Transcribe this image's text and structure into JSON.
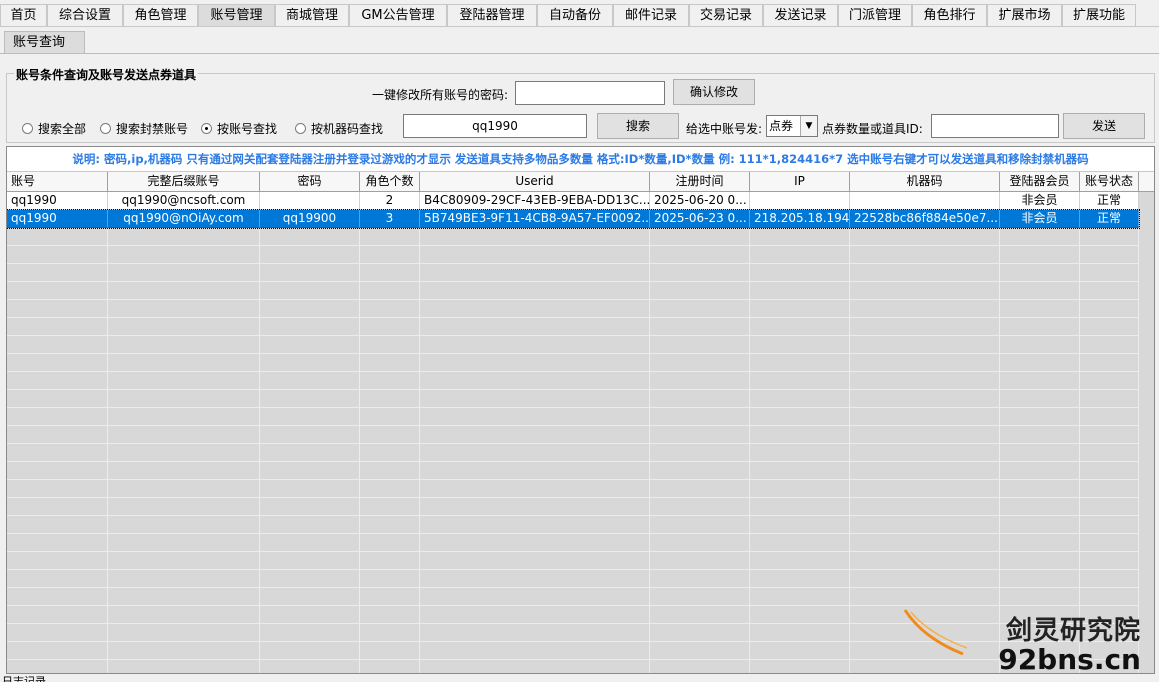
{
  "tabs": [
    "首页",
    "综合设置",
    "角色管理",
    "账号管理",
    "商城管理",
    "GM公告管理",
    "登陆器管理",
    "自动备份",
    "邮件记录",
    "交易记录",
    "发送记录",
    "门派管理",
    "角色排行",
    "扩展市场",
    "扩展功能"
  ],
  "active_tab": "账号管理",
  "subtab": "账号查询",
  "group_title": "账号条件查询及账号发送点券道具",
  "password_change": {
    "label": "一键修改所有账号的密码:",
    "value": "",
    "button": "确认修改"
  },
  "radios": [
    {
      "label": "搜索全部",
      "checked": false
    },
    {
      "label": "搜索封禁账号",
      "checked": false
    },
    {
      "label": "按账号查找",
      "checked": true
    },
    {
      "label": "按机器码查找",
      "checked": false
    }
  ],
  "search": {
    "value": "qq1990",
    "button": "搜索"
  },
  "send": {
    "label": "给选中账号发:",
    "select_value": "点券",
    "amount_label": "点券数量或道具ID:",
    "amount_value": "",
    "button": "发送"
  },
  "note": "说明: 密码,ip,机器码 只有通过网关配套登陆器注册并登录过游戏的才显示 发送道具支持多物品多数量 格式:ID*数量,ID*数量 例: 111*1,824416*7  选中账号右键才可以发送道具和移除封禁机器码",
  "table": {
    "columns": [
      "账号",
      "完整后缀账号",
      "密码",
      "角色个数",
      "Userid",
      "注册时间",
      "IP",
      "机器码",
      "登陆器会员",
      "账号状态"
    ],
    "rows": [
      [
        "qq1990",
        "qq1990@ncsoft.com",
        "",
        "2",
        "B4C80909-29CF-43EB-9EBA-DD13C...",
        "2025-06-20 0...",
        "",
        "",
        "非会员",
        "正常"
      ],
      [
        "qq1990",
        "qq1990@nOiAy.com",
        "qq19900",
        "3",
        "5B749BE3-9F11-4CB8-9A57-EF0092...",
        "2025-06-23 0...",
        "218.205.18.194",
        "22528bc86f884e50e7...",
        "非会员",
        "正常"
      ]
    ],
    "selected_row": 1
  },
  "watermark": {
    "cn": "剑灵研究院",
    "en": "92bns.cn"
  },
  "log_label": "日志记录"
}
